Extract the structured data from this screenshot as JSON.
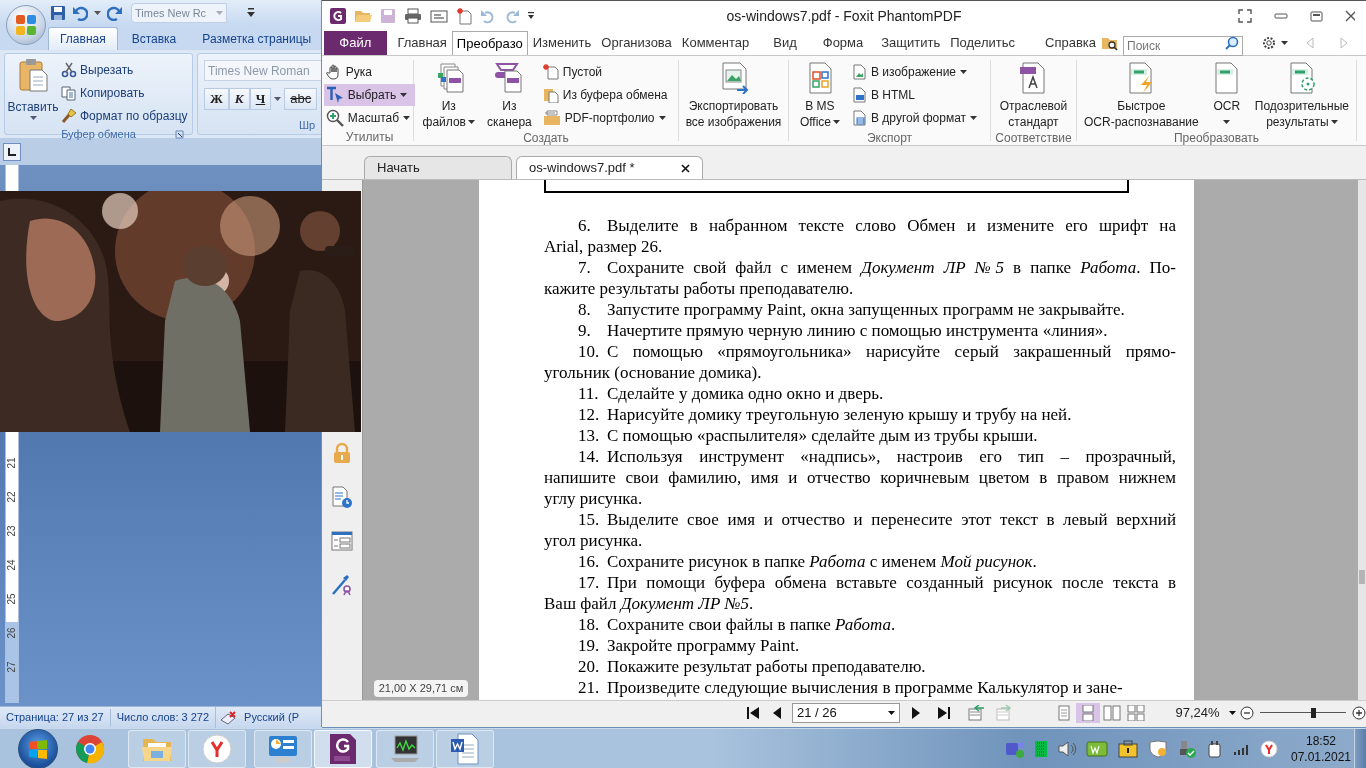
{
  "word": {
    "qat_font": "Times New Rc",
    "tabs": [
      {
        "label": "Главная",
        "selected": true
      },
      {
        "label": "Вставка",
        "selected": false
      },
      {
        "label": "Разметка страницы",
        "selected": false
      }
    ],
    "paste": "Вставить",
    "clipboard_items": [
      "Вырезать",
      "Копировать",
      "Формат по образцу"
    ],
    "clipboard_group": "Буфер обмена",
    "font_name": "Times New Roman",
    "format_buttons": [
      "Ж",
      "К",
      "Ч",
      "abc"
    ],
    "font_group": "Шр",
    "ruler_marks": [
      "21",
      "22",
      "23",
      "24",
      "25",
      "26",
      "27"
    ],
    "status": [
      "Страница: 27 из 27",
      "Число слов: 3 272",
      "Русский (Р"
    ]
  },
  "foxit": {
    "title": "os-windows7.pdf - Foxit PhantomPDF",
    "file_menu": "Файл",
    "tabs": [
      {
        "label": "Главная",
        "selected": false
      },
      {
        "label": "Преобразо",
        "selected": true
      },
      {
        "label": "Изменить",
        "selected": false
      },
      {
        "label": "Организова",
        "selected": false
      },
      {
        "label": "Комментар",
        "selected": false
      },
      {
        "label": "Вид",
        "selected": false
      },
      {
        "label": "Форма",
        "selected": false
      },
      {
        "label": "Защитить",
        "selected": false
      },
      {
        "label": "Поделитьс",
        "selected": false
      },
      {
        "label": "Справка",
        "selected": false
      }
    ],
    "search_placeholder": "Поиск",
    "groups": [
      {
        "label": "Утилиты",
        "columns": [
          {
            "kind": "stack",
            "items": [
              {
                "label": "Рука",
                "selected": false
              },
              {
                "label": "Выбрать",
                "selected": true,
                "dropdown": true
              },
              {
                "label": "Масштаб",
                "selected": false,
                "dropdown": true
              }
            ]
          }
        ]
      },
      {
        "label": "Создать",
        "columns": [
          {
            "kind": "large",
            "lines": [
              "Из",
              "файлов"
            ],
            "dropdown": true
          },
          {
            "kind": "large",
            "lines": [
              "Из",
              "сканера"
            ]
          },
          {
            "kind": "stack",
            "items": [
              {
                "label": "Пустой"
              },
              {
                "label": "Из буфера обмена"
              },
              {
                "label": "PDF-портфолио",
                "dropdown": true
              }
            ]
          }
        ]
      },
      {
        "columns": [
          {
            "kind": "large",
            "lines": [
              "Экспортировать",
              "все изображения"
            ]
          }
        ]
      },
      {
        "label": "Экспорт",
        "columns": [
          {
            "kind": "large",
            "lines": [
              "В MS",
              "Office"
            ],
            "dropdown": true
          },
          {
            "kind": "stack",
            "items": [
              {
                "label": "В изображение",
                "dropdown": true
              },
              {
                "label": "В HTML"
              },
              {
                "label": "В другой формат",
                "dropdown": true
              }
            ]
          }
        ]
      },
      {
        "label": "Соответствие",
        "columns": [
          {
            "kind": "large",
            "lines": [
              "Отраслевой",
              "стандарт"
            ]
          }
        ]
      },
      {
        "label": "Преобразовать",
        "columns": [
          {
            "kind": "large",
            "lines": [
              "Быстрое",
              "OCR-распознавание"
            ]
          },
          {
            "kind": "large",
            "lines": [
              "OCR"
            ],
            "dropdown": true
          },
          {
            "kind": "large",
            "lines": [
              "Подозрительные",
              "результаты"
            ],
            "dropdown": true
          }
        ]
      }
    ],
    "doc_tabs": [
      {
        "label": "Начать",
        "selected": false
      },
      {
        "label": "os-windows7.pdf *",
        "selected": true
      }
    ],
    "page_size": "21,00 X 29,71 см",
    "items": [
      {
        "number": "6.",
        "lines": [
          "Выделите в набранном тексте слово Обмен и измените его шрифт на",
          "Arial, размер 26."
        ]
      },
      {
        "number": "7.",
        "lines": [
          "Сохраните свой файл с именем *Документ ЛР №5* в папке *Работа*. По-",
          "кажите результаты работы преподавателю."
        ]
      },
      {
        "number": "8.",
        "lines": [
          "Запустите программу Paint, окна запущенных программ не закрывайте."
        ]
      },
      {
        "number": "9.",
        "lines": [
          "Начертите прямую черную линию с помощью инструмента «линия»."
        ]
      },
      {
        "number": "10.",
        "lines": [
          "С помощью «прямоугольника» нарисуйте серый закрашенный прямо-",
          "угольник (основание домика)."
        ]
      },
      {
        "number": "11.",
        "lines": [
          "Сделайте у домика одно окно и дверь."
        ]
      },
      {
        "number": "12.",
        "lines": [
          "Нарисуйте домику треугольную зеленую крышу и трубу на ней."
        ]
      },
      {
        "number": "13.",
        "lines": [
          "С помощью «распылителя» сделайте дым из трубы крыши."
        ]
      },
      {
        "number": "14.",
        "lines": [
          "Используя инструмент «надпись», настроив его тип – прозрачный,",
          "напишите свои фамилию, имя и отчество коричневым цветом в правом нижнем",
          "углу рисунка."
        ]
      },
      {
        "number": "15.",
        "lines": [
          "Выделите свое имя и отчество и перенесите этот текст в левый верхний",
          "угол рисунка."
        ]
      },
      {
        "number": "16.",
        "lines": [
          "Сохраните рисунок в папке *Работа* с именем *Мой рисунок*."
        ]
      },
      {
        "number": "17.",
        "lines": [
          "При помощи буфера обмена вставьте созданный рисунок после текста в",
          "Ваш файл *Документ ЛР №5*."
        ]
      },
      {
        "number": "18.",
        "lines": [
          "Сохраните свои файлы в папке *Работа*."
        ]
      },
      {
        "number": "19.",
        "lines": [
          "Закройте программу Paint."
        ]
      },
      {
        "number": "20.",
        "lines": [
          "Покажите результат работы преподавателю."
        ]
      },
      {
        "number": "21.",
        "lines": [
          "Произведите следующие вычисления в программе Калькулятор и зане-"
        ]
      }
    ],
    "page_field": "21 / 26",
    "view_modes": [
      {
        "selected": false
      },
      {
        "selected": true
      },
      {
        "selected": false
      },
      {
        "selected": false
      }
    ],
    "zoom": "97,24%",
    "zoom_slider": {
      "level": 0.62
    }
  },
  "taskbar": {
    "apps": [
      {
        "open": false,
        "selected": false
      },
      {
        "open": true,
        "selected": false
      },
      {
        "open": true,
        "selected": false
      },
      {
        "open": true,
        "selected": false
      },
      {
        "open": true,
        "selected": true
      },
      {
        "open": true,
        "selected": false
      },
      {
        "open": true,
        "selected": false
      }
    ],
    "time": "18:52",
    "date": "07.01.2021"
  }
}
